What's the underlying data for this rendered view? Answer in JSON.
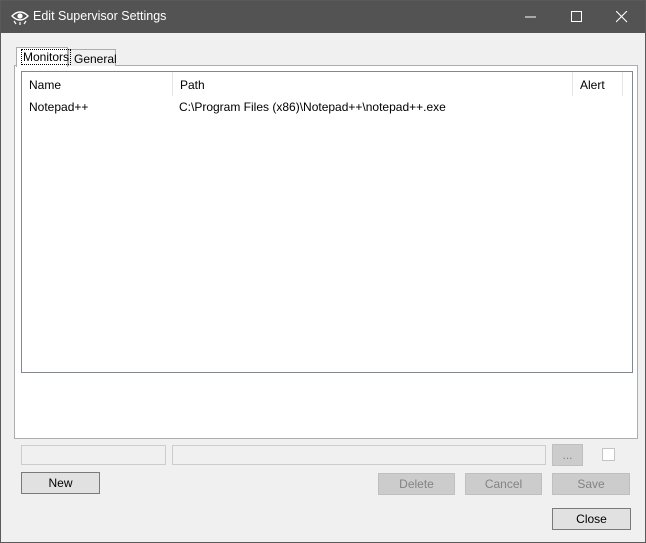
{
  "window": {
    "title": "Edit Supervisor Settings",
    "app_icon": "eye-icon",
    "controls": [
      "minimize-icon",
      "maximize-icon",
      "close-icon"
    ]
  },
  "tabs": [
    {
      "label": "Monitors",
      "selected": true
    },
    {
      "label": "General",
      "selected": false
    }
  ],
  "monitors": {
    "columns": [
      "Name",
      "Path",
      "Alert"
    ],
    "rows": [
      {
        "name": "Notepad++",
        "path": "C:\\Program Files (x86)\\Notepad++\\notepad++.exe",
        "alert": ""
      }
    ]
  },
  "editor": {
    "name_value": "",
    "path_value": "",
    "browse_label": "...",
    "alert_checked": false
  },
  "buttons": {
    "new": "New",
    "delete": "Delete",
    "cancel": "Cancel",
    "save": "Save",
    "close": "Close"
  },
  "colors": {
    "titlebar": "#535353",
    "disabled_button": "#cccccc",
    "button": "#e1e1e1"
  }
}
